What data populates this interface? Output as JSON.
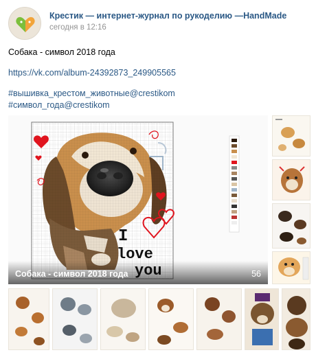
{
  "post": {
    "author": "Крестик — интернет-журнал по рукоделию —HandMade",
    "date": "сегодня в 12:16",
    "title": "Собака - символ 2018 года",
    "link": "https://vk.com/album-24392873_249905565",
    "tags": [
      "#вышивка_крестом_животные@crestikom",
      "#символ_года@crestikom"
    ]
  },
  "album": {
    "title": "Собака - символ 2018 года",
    "count": "56",
    "pattern_text": [
      "I",
      "love",
      "you"
    ]
  },
  "colors": {
    "link": "#2a5885",
    "date": "#939393",
    "heart": "#e0141e"
  }
}
